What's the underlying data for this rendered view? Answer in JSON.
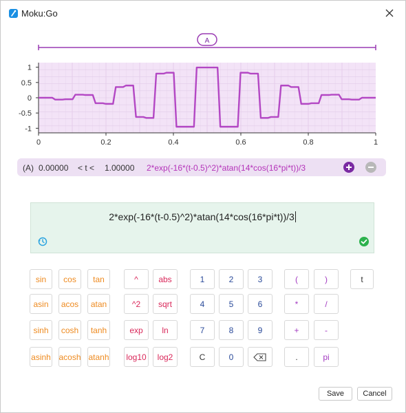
{
  "window": {
    "title": "Moku:Go"
  },
  "chart": {
    "range_label": "A",
    "colors": {
      "trace": "#b347c4",
      "fill": "#f3e3f7",
      "bracket": "#9a3bb3"
    }
  },
  "chart_data": {
    "type": "line",
    "title": "",
    "xlabel": "",
    "ylabel": "",
    "xlim": [
      0,
      1
    ],
    "ylim": [
      -1.15,
      1.15
    ],
    "x_ticks": [
      "0",
      "0.2",
      "0.4",
      "0.6",
      "0.8",
      "1"
    ],
    "y_ticks": [
      "1",
      "0.5",
      "0",
      "-0.5",
      "-1"
    ],
    "grid": true,
    "series": [
      {
        "x": [
          0,
          0.03,
          0.06,
          0.09,
          0.12,
          0.15,
          0.18,
          0.21,
          0.24,
          0.27,
          0.3,
          0.33,
          0.36,
          0.39,
          0.42,
          0.45,
          0.48,
          0.5,
          0.52,
          0.55,
          0.58,
          0.61,
          0.64,
          0.67,
          0.7,
          0.73,
          0.76,
          0.79,
          0.82,
          0.85,
          0.88,
          0.91,
          0.94,
          0.97,
          1.0
        ],
        "y": [
          0.0,
          0.0,
          -0.06,
          -0.05,
          0.1,
          0.09,
          -0.18,
          -0.2,
          0.35,
          0.4,
          -0.63,
          -0.66,
          0.79,
          0.82,
          -0.95,
          -0.95,
          0.99,
          0.99,
          0.99,
          -0.95,
          -0.95,
          0.82,
          0.79,
          -0.66,
          -0.63,
          0.4,
          0.35,
          -0.2,
          -0.18,
          0.09,
          0.1,
          -0.05,
          -0.06,
          0.0,
          0.0
        ]
      }
    ]
  },
  "function_bar": {
    "label": "(A)",
    "t_min": "0.00000",
    "relation": "< t <",
    "t_max": "1.00000",
    "expression": "2*exp(-16*(t-0.5)^2)*atan(14*cos(16*pi*t))/3"
  },
  "editor": {
    "value": "2*exp(-16*(t-0.5)^2)*atan(14*cos(16*pi*t))/3",
    "icons": {
      "history": "history-icon",
      "valid": "check-circle-icon"
    }
  },
  "keypad": {
    "trig": [
      "sin",
      "cos",
      "tan",
      "asin",
      "acos",
      "atan",
      "sinh",
      "cosh",
      "tanh",
      "asinh",
      "acosh",
      "atanh"
    ],
    "funcs": [
      "^",
      "abs",
      "^2",
      "sqrt",
      "exp",
      "ln",
      "log10",
      "log2"
    ],
    "digits": [
      "1",
      "2",
      "3",
      "4",
      "5",
      "6",
      "7",
      "8",
      "9",
      "C",
      "0"
    ],
    "backspace_icon": "backspace-icon",
    "ops": [
      "(",
      ")",
      "*",
      "/",
      "+",
      "-",
      ".",
      "pi"
    ],
    "var": "t"
  },
  "actions": {
    "save": "Save",
    "cancel": "Cancel"
  }
}
